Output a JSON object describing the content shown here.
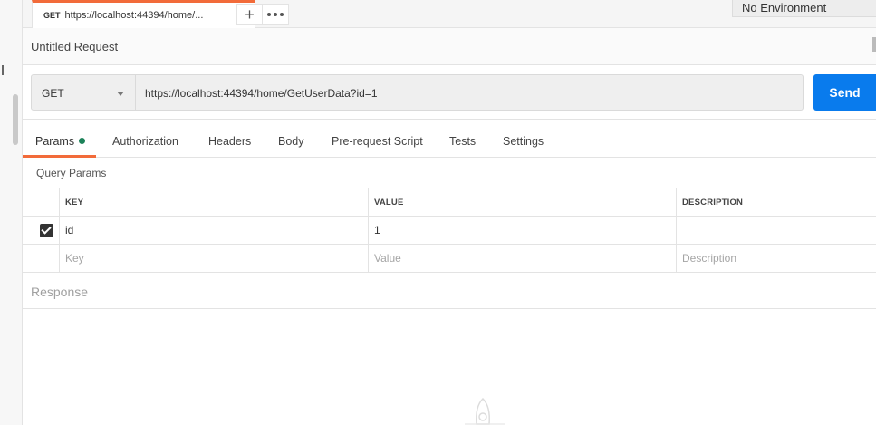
{
  "tab": {
    "method": "GET",
    "title": "https://localhost:44394/home/..."
  },
  "environment": {
    "selected": "No Environment"
  },
  "request": {
    "name": "Untitled Request",
    "method": "GET",
    "url": "https://localhost:44394/home/GetUserData?id=1",
    "send_label": "Send"
  },
  "subtabs": [
    {
      "label": "Params",
      "active": true,
      "indicator": true
    },
    {
      "label": "Authorization"
    },
    {
      "label": "Headers"
    },
    {
      "label": "Body"
    },
    {
      "label": "Pre-request Script"
    },
    {
      "label": "Tests"
    },
    {
      "label": "Settings"
    }
  ],
  "query_params": {
    "section_label": "Query Params",
    "columns": [
      "KEY",
      "VALUE",
      "DESCRIPTION"
    ],
    "rows": [
      {
        "checked": true,
        "key": "id",
        "value": "1",
        "description": ""
      }
    ],
    "placeholder": {
      "key": "Key",
      "value": "Value",
      "description": "Description"
    }
  },
  "response": {
    "label": "Response"
  },
  "colors": {
    "accent": "#f26b3a",
    "send": "#097bed",
    "indicator": "#1c8259"
  }
}
